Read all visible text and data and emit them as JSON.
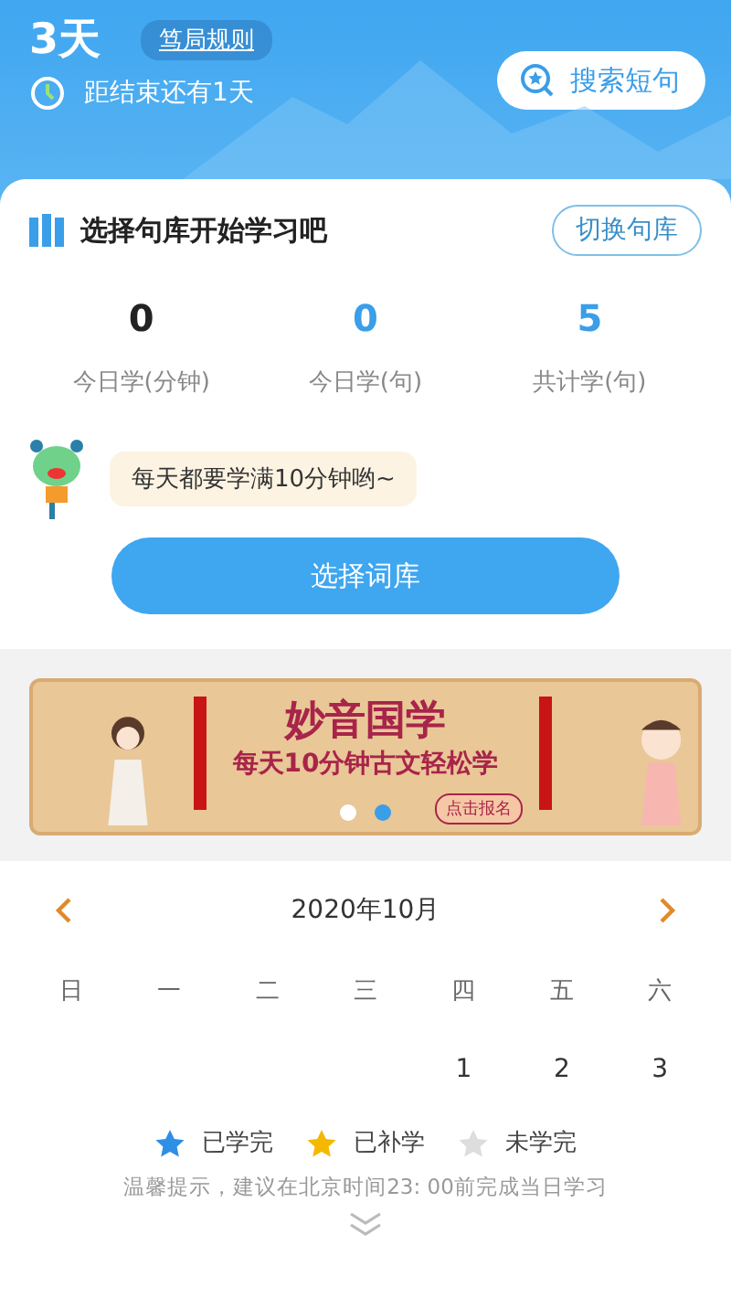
{
  "header": {
    "days": "3天",
    "rule_link": "笃局规则",
    "countdown": "距结束还有1天",
    "search_button": "搜索短句"
  },
  "study_card": {
    "title": "选择句库开始学习吧",
    "switch_button": "切换句库",
    "stats": [
      {
        "value": "0",
        "label": "今日学(分钟)",
        "color": "#222222"
      },
      {
        "value": "0",
        "label": "今日学(句)",
        "color": "#3a9ee8"
      },
      {
        "value": "5",
        "label": "共计学(句)",
        "color": "#3a9ee8"
      }
    ],
    "tip_bubble": "每天都要学满10分钟哟~",
    "primary_button": "选择词库"
  },
  "banner": {
    "title": "妙音国学",
    "subtitle": "每天10分钟古文轻松学",
    "cta": "点击报名",
    "dots": [
      {
        "selected": false
      },
      {
        "selected": true
      }
    ]
  },
  "calendar": {
    "month": "2020年10月",
    "weekdays": [
      "日",
      "一",
      "二",
      "三",
      "四",
      "五",
      "六"
    ],
    "weeks": [
      [
        {
          "kind": "empty"
        },
        {
          "kind": "empty"
        },
        {
          "kind": "empty"
        },
        {
          "kind": "empty"
        },
        {
          "kind": "day",
          "label": "1"
        },
        {
          "kind": "day",
          "label": "2"
        },
        {
          "kind": "day",
          "label": "3"
        }
      ]
    ],
    "legend": [
      {
        "label": "已学完",
        "color": "#2d8fe6"
      },
      {
        "label": "已补学",
        "color": "#f5b800"
      },
      {
        "label": "未学完",
        "color": "#dddddd"
      }
    ],
    "tip": "温馨提示，建议在北京时间23: 00前完成当日学习"
  }
}
